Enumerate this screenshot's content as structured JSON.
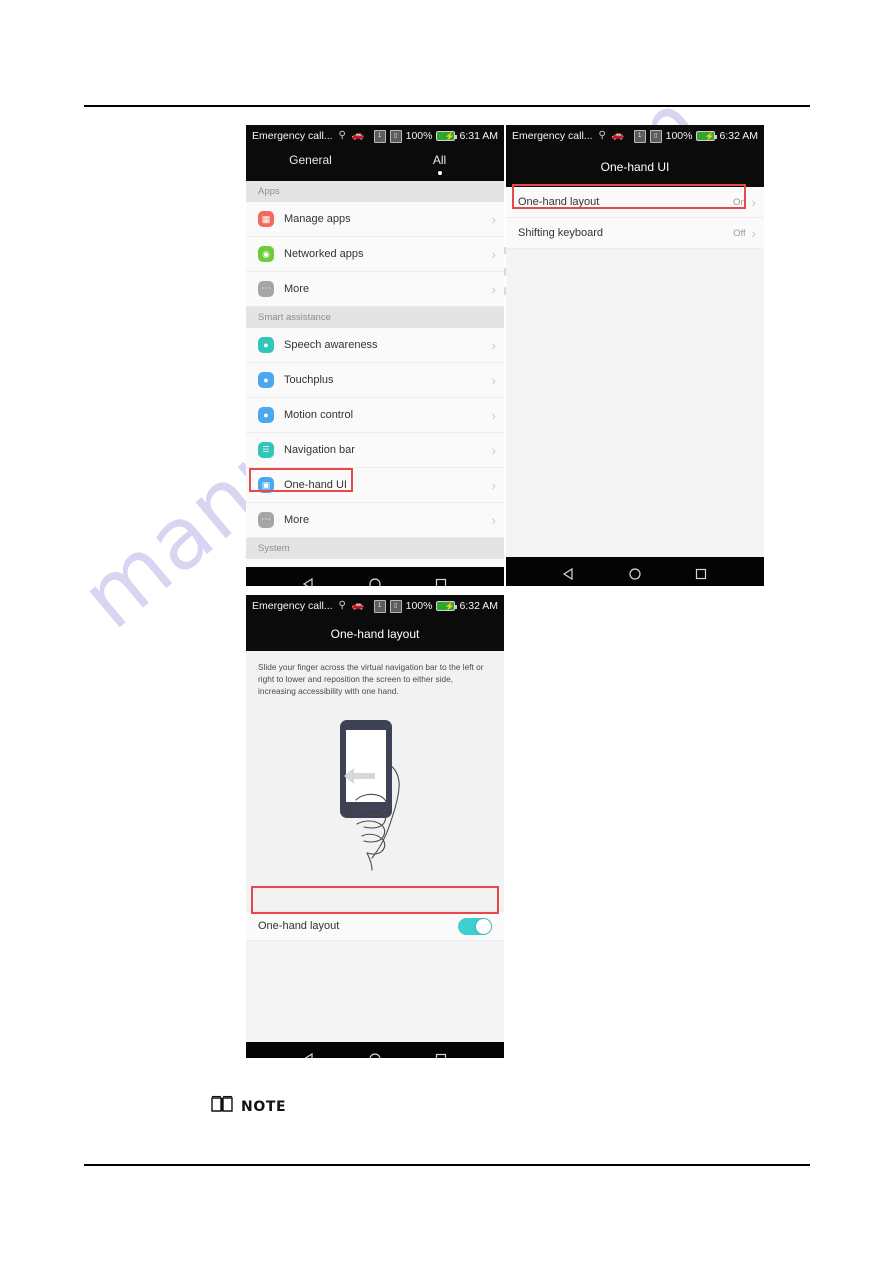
{
  "document": {
    "note_label": "NOTE",
    "note_icon": "book-icon",
    "watermark": "manualshive.com"
  },
  "screens": [
    {
      "id": "settings-all",
      "statusbar": {
        "carrier": "Emergency call...",
        "icons": [
          "location-icon",
          "car-icon"
        ],
        "sim_icon": "sim-card-icon",
        "doc_icon": "document-icon",
        "battery_percent": "100%",
        "battery_icon": "battery-charging-icon",
        "time": "6:31 AM"
      },
      "tabs": [
        {
          "label": "General",
          "selected": false
        },
        {
          "label": "All",
          "selected": true
        }
      ],
      "sections": [
        {
          "header": "Apps",
          "rows": [
            {
              "label": "Manage apps",
              "icon": "manage-apps-icon",
              "icon_color": "#f2695e",
              "glyph": "▦",
              "chevron": true
            },
            {
              "label": "Networked apps",
              "icon": "networked-apps-icon",
              "icon_color": "#6ecb3a",
              "glyph": "◎",
              "chevron": true
            },
            {
              "label": "More",
              "icon": "more-icon",
              "icon_color": "#a6a6a6",
              "glyph": "…",
              "chevron": true
            }
          ]
        },
        {
          "header": "Smart assistance",
          "rows": [
            {
              "label": "Speech awareness",
              "icon": "speech-awareness-icon",
              "icon_color": "#31c6b8",
              "glyph": "◉",
              "chevron": true
            },
            {
              "label": "Touchplus",
              "icon": "touchplus-icon",
              "icon_color": "#4aa8f0",
              "glyph": "⑂",
              "chevron": true
            },
            {
              "label": "Motion control",
              "icon": "motion-control-icon",
              "icon_color": "#4aa8f0",
              "glyph": "⑂",
              "chevron": true
            },
            {
              "label": "Navigation bar",
              "icon": "navigation-bar-icon",
              "icon_color": "#31c6b8",
              "glyph": "☰",
              "chevron": true
            },
            {
              "label": "One-hand UI",
              "icon": "one-hand-ui-icon",
              "icon_color": "#4aa8f0",
              "glyph": "◨",
              "chevron": true,
              "highlighted": true
            },
            {
              "label": "More",
              "icon": "more-icon",
              "icon_color": "#a6a6a6",
              "glyph": "…",
              "chevron": true
            }
          ]
        },
        {
          "header": "System",
          "rows": []
        }
      ],
      "navbar": [
        "back-icon",
        "home-icon",
        "recents-icon"
      ]
    },
    {
      "id": "one-hand-ui",
      "statusbar": {
        "carrier": "Emergency call...",
        "icons": [
          "location-icon",
          "car-icon"
        ],
        "battery_percent": "100%",
        "time": "6:32 AM"
      },
      "title": "One-hand UI",
      "rows": [
        {
          "label": "One-hand layout",
          "value": "On",
          "chevron": true,
          "highlighted": true
        },
        {
          "label": "Shifting keyboard",
          "value": "Off",
          "chevron": true,
          "highlighted": false
        }
      ],
      "navbar": [
        "back-icon",
        "home-icon",
        "recents-icon"
      ]
    },
    {
      "id": "one-hand-layout",
      "statusbar": {
        "carrier": "Emergency call...",
        "icons": [
          "location-icon",
          "car-icon"
        ],
        "battery_percent": "100%",
        "time": "6:32 AM"
      },
      "title": "One-hand layout",
      "description": "Slide your finger across the virtual navigation bar to the left or right to lower and reposition the screen to either side, increasing accessibility with one hand.",
      "illustration": "hand-holding-phone-swipe-illustration",
      "toggle": {
        "label": "One-hand layout",
        "state": "on"
      },
      "navbar": [
        "back-icon",
        "home-icon",
        "recents-icon"
      ]
    }
  ],
  "colors": {
    "highlight_red": "#e8484c",
    "switch_on": "#3ecfcf",
    "status_bar": "#0b0b0b",
    "list_bg": "#fafafa",
    "section_bg": "#e4e4e4"
  }
}
